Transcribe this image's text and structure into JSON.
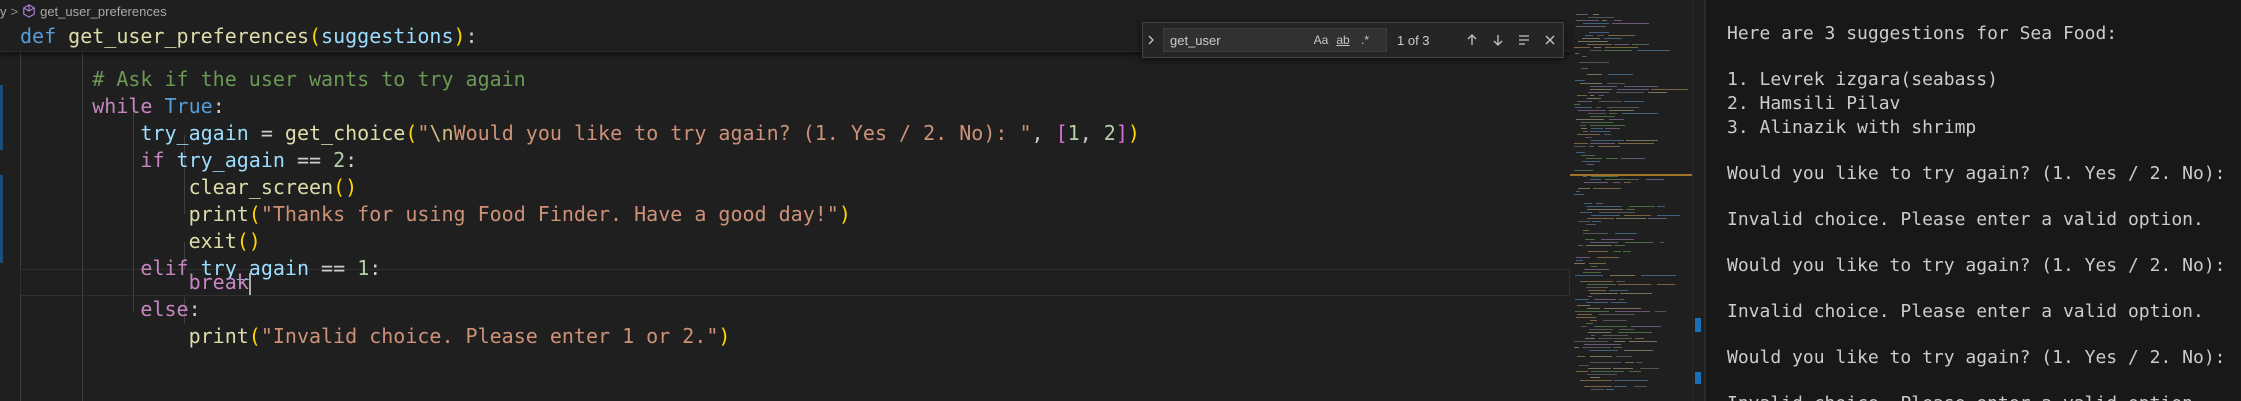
{
  "breadcrumb": {
    "parent": "y",
    "separator": ">",
    "symbol": "get_user_preferences",
    "symbol_icon": "cube-icon"
  },
  "find": {
    "query": "get_user",
    "match_case_label": "Aa",
    "whole_word_label": "ab",
    "regex_label": ".*",
    "count": "1 of 3"
  },
  "sticky": {
    "def": "def",
    "name": "get_user_preferences",
    "param": "suggestions",
    "colon": ":"
  },
  "code": {
    "comment": "# Ask if the user wants to try again",
    "while_kw": "while",
    "true_kw": "True",
    "colon": ":",
    "var_try_again": "try_again",
    "assign": " = ",
    "get_choice": "get_choice",
    "prompt_q": "\"",
    "prompt_esc": "\\n",
    "prompt_text": "Would you like to try again? (1. Yes / 2. No): \"",
    "comma": ", ",
    "num1": "1",
    "num2": "2",
    "if_kw": "if",
    "eq2": " == ",
    "two": "2",
    "clear_screen": "clear_screen",
    "print": "print",
    "thanks_str": "\"Thanks for using Food Finder. Have a good day!\"",
    "exit": "exit",
    "elif_kw": "elif",
    "one": "1",
    "break_kw": "break",
    "else_kw": "else",
    "invalid_str": "\"Invalid choice. Please enter 1 or 2.\""
  },
  "terminal": {
    "lines": [
      "Here are 3 suggestions for Sea Food:",
      "1. Levrek izgara(seabass)",
      "2. Hamsili Pilav",
      "3. Alinazik with shrimp",
      "Would you like to try again? (1. Yes / 2. No):",
      "Invalid choice. Please enter a valid option.",
      "Would you like to try again? (1. Yes / 2. No):",
      "Invalid choice. Please enter a valid option.",
      "Would you like to try again? (1. Yes / 2. No):",
      "Invalid choice. Please enter a valid option."
    ]
  },
  "colors": {
    "keyword": "#569cd6",
    "control": "#c586c0",
    "function": "#dcdcaa",
    "string": "#ce9178",
    "number": "#b5cea8",
    "comment": "#6a9955",
    "bracket_1": "#ffd700",
    "bracket_2": "#da70d6",
    "bracket_3": "#179fff"
  }
}
